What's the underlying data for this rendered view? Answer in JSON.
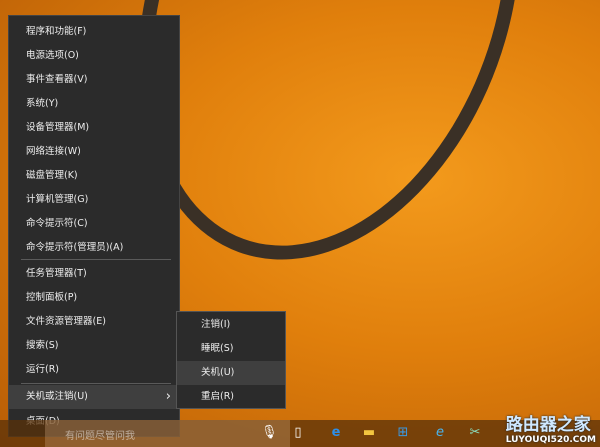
{
  "menu": {
    "items": [
      "程序和功能(F)",
      "电源选项(O)",
      "事件查看器(V)",
      "系统(Y)",
      "设备管理器(M)",
      "网络连接(W)",
      "磁盘管理(K)",
      "计算机管理(G)",
      "命令提示符(C)",
      "命令提示符(管理员)(A)",
      "任务管理器(T)",
      "控制面板(P)",
      "文件资源管理器(E)",
      "搜索(S)",
      "运行(R)",
      "关机或注销(U)",
      "桌面(D)"
    ],
    "submenu_arrow": "›"
  },
  "submenu": {
    "items": [
      "注销(I)",
      "睡眠(S)",
      "关机(U)",
      "重启(R)"
    ]
  },
  "taskbar": {
    "search_placeholder": "有问题尽管问我"
  },
  "watermark": {
    "title": "路由器之家",
    "url": "LUYOUQI520.COM"
  }
}
